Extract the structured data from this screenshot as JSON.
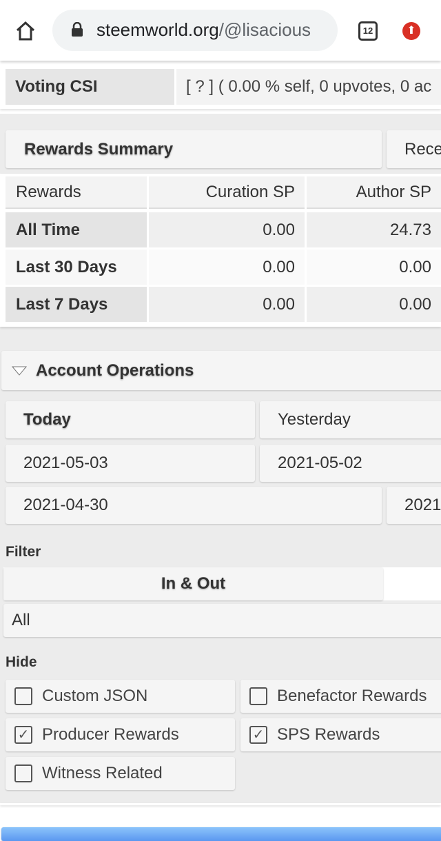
{
  "browser": {
    "url_domain": "steemworld.org",
    "url_path": "/@lisacious",
    "tab_count": "12",
    "home_icon": "home-icon",
    "lock_icon": "lock-icon",
    "extension_icon": "upload-arrow-icon"
  },
  "voting_csi": {
    "label": "Voting CSI",
    "value": "[ ? ] ( 0.00 % self, 0 upvotes, 0 ac"
  },
  "rewards": {
    "tabs": [
      "Rewards Summary",
      "Rece"
    ],
    "headers": [
      "Rewards",
      "Curation SP",
      "Author SP"
    ],
    "rows": [
      [
        "All Time",
        "0.00",
        "24.73"
      ],
      [
        "Last 30 Days",
        "0.00",
        "0.00"
      ],
      [
        "Last 7 Days",
        "0.00",
        "0.00"
      ]
    ]
  },
  "operations": {
    "title": "Account Operations",
    "days": [
      "Today",
      "Yesterday",
      "2021-05-03",
      "2021-05-02",
      "2021-04-30",
      "2021"
    ],
    "filter_label": "Filter",
    "filter_selected": "In & Out",
    "filter_value": "All",
    "hide_label": "Hide",
    "hide_options": [
      {
        "label": "Custom JSON",
        "checked": false
      },
      {
        "label": "Benefactor Rewards",
        "checked": false
      },
      {
        "label": "Producer Rewards",
        "checked": true
      },
      {
        "label": "SPS Rewards",
        "checked": true
      },
      {
        "label": "Witness Related",
        "checked": false
      }
    ]
  },
  "colors": {
    "accent": "#5b98f0",
    "danger": "#d93025"
  }
}
